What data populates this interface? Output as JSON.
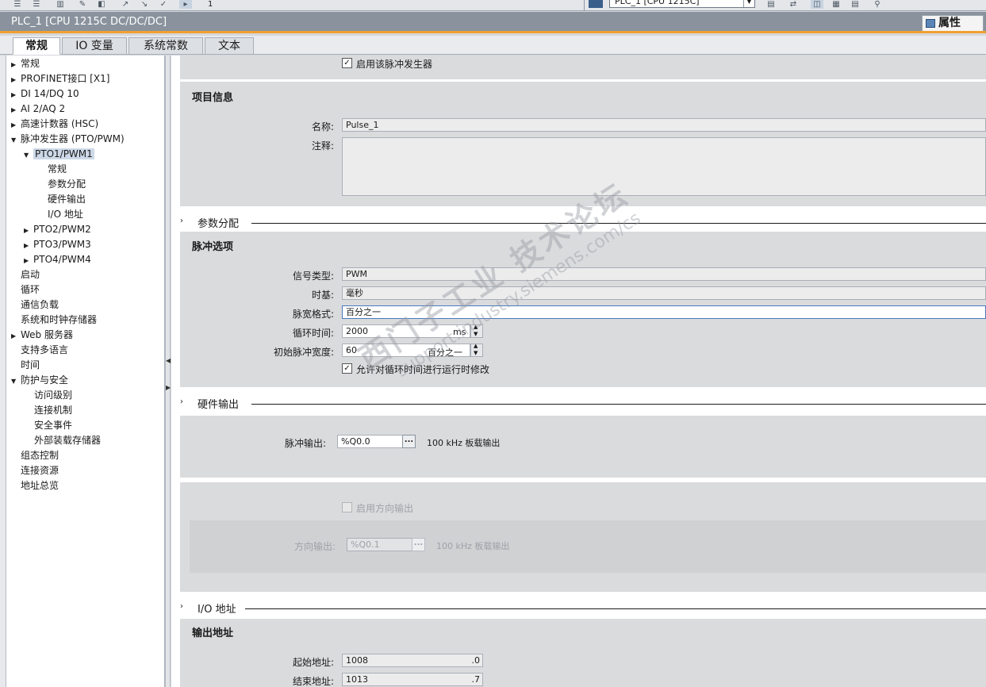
{
  "toolbar": {
    "page_number": "1",
    "device_select": "PLC_1 [CPU 1215C]"
  },
  "window": {
    "title": "PLC_1 [CPU 1215C DC/DC/DC]",
    "properties_tab": "属性"
  },
  "tabs": [
    "常规",
    "IO 变量",
    "系统常数",
    "文本"
  ],
  "nav": {
    "items": [
      {
        "label": "常规"
      },
      {
        "label": "PROFINET接口 [X1]"
      },
      {
        "label": "DI 14/DQ 10"
      },
      {
        "label": "AI 2/AQ 2"
      },
      {
        "label": "高速计数器 (HSC)"
      },
      {
        "label": "脉冲发生器 (PTO/PWM)"
      },
      {
        "label": "PTO1/PWM1"
      },
      {
        "label": "常规"
      },
      {
        "label": "参数分配"
      },
      {
        "label": "硬件输出"
      },
      {
        "label": "I/O 地址"
      },
      {
        "label": "PTO2/PWM2"
      },
      {
        "label": "PTO3/PWM3"
      },
      {
        "label": "PTO4/PWM4"
      },
      {
        "label": "启动"
      },
      {
        "label": "循环"
      },
      {
        "label": "通信负载"
      },
      {
        "label": "系统和时钟存储器"
      },
      {
        "label": "Web 服务器"
      },
      {
        "label": "支持多语言"
      },
      {
        "label": "时间"
      },
      {
        "label": "防护与安全"
      },
      {
        "label": "访问级别"
      },
      {
        "label": "连接机制"
      },
      {
        "label": "安全事件"
      },
      {
        "label": "外部装载存储器"
      },
      {
        "label": "组态控制"
      },
      {
        "label": "连接资源"
      },
      {
        "label": "地址总览"
      }
    ]
  },
  "enable": {
    "label": "启用该脉冲发生器",
    "checked": true
  },
  "project_info": {
    "title": "项目信息",
    "name_label": "名称:",
    "name_value": "Pulse_1",
    "comment_label": "注释:",
    "comment_value": ""
  },
  "param": {
    "header": "参数分配",
    "title": "脉冲选项",
    "signal_type_label": "信号类型:",
    "signal_type_value": "PWM",
    "time_base_label": "时基:",
    "time_base_value": "毫秒",
    "pulse_format_label": "脉宽格式:",
    "pulse_format_value": "百分之一",
    "cycle_time_label": "循环时间:",
    "cycle_time_value": "2000",
    "cycle_time_unit": "ms",
    "initial_width_label": "初始脉冲宽度:",
    "initial_width_value": "60",
    "initial_width_unit": "百分之一",
    "allow_runtime_label": "允许对循环时间进行运行时修改",
    "allow_runtime_checked": true
  },
  "hardware": {
    "header": "硬件输出",
    "pulse_output_label": "脉冲输出:",
    "pulse_output_value": "%Q0.0",
    "pulse_output_info": "100 kHz 板载输出",
    "enable_direction_label": "启用方向输出",
    "enable_direction_checked": false,
    "direction_label": "方向输出:",
    "direction_value": "%Q0.1",
    "direction_info": "100 kHz 板载输出",
    "browse_label": "..."
  },
  "io": {
    "header": "I/O 地址",
    "title": "输出地址",
    "start_label": "起始地址:",
    "start_value": "1008",
    "start_bit": ".0",
    "end_label": "结束地址:",
    "end_value": "1013",
    "end_bit": ".7"
  },
  "watermark": {
    "line1": "西门子工业 技术论坛",
    "line2": "support.industry.siemens.com/cs"
  }
}
